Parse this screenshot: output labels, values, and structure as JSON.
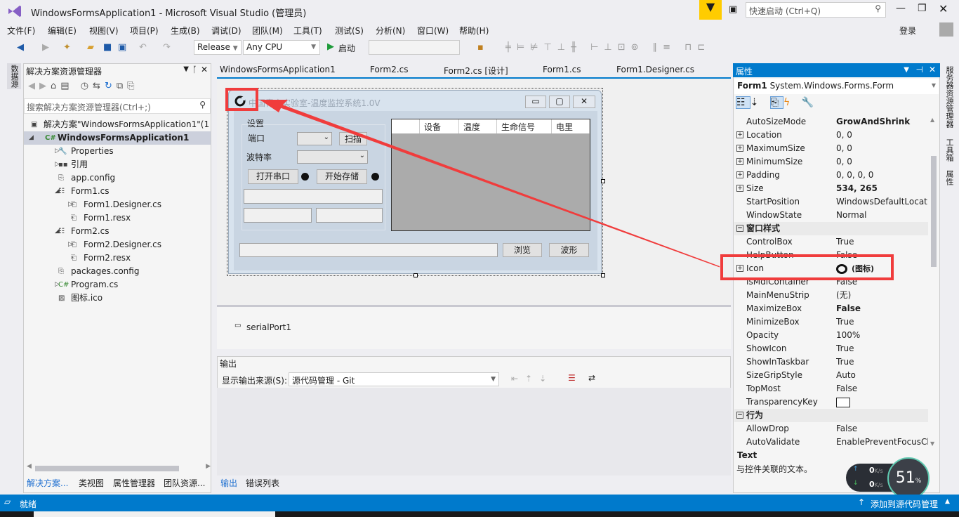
{
  "window": {
    "title": "WindowsFormsApplication1 - Microsoft Visual Studio (管理员)",
    "quick_launch_placeholder": "快速启动 (Ctrl+Q)",
    "login": "登录"
  },
  "menu": [
    "文件(F)",
    "编辑(E)",
    "视图(V)",
    "项目(P)",
    "生成(B)",
    "调试(D)",
    "团队(M)",
    "工具(T)",
    "测试(S)",
    "分析(N)",
    "窗口(W)",
    "帮助(H)"
  ],
  "toolbar": {
    "config": "Release",
    "platform": "Any CPU",
    "start": "启动"
  },
  "left_vertical_tab": "数据源",
  "right_vertical_tabs": [
    "服务器资源管理器",
    "工具箱",
    "属性"
  ],
  "solution_explorer": {
    "title": "解决方案资源管理器",
    "search_placeholder": "搜索解决方案资源管理器(Ctrl+;)",
    "items": [
      {
        "label": "解决方案\"WindowsFormsApplication1\"(1",
        "indent": 0,
        "arrow": "",
        "icon": "solution-icon"
      },
      {
        "label": "WindowsFormsApplication1",
        "indent": 0,
        "arrow": "◢",
        "icon": "csharp-project-icon",
        "selected": true
      },
      {
        "label": "Properties",
        "indent": 1,
        "arrow": "▷",
        "icon": "wrench-icon"
      },
      {
        "label": "引用",
        "indent": 1,
        "arrow": "▷",
        "icon": "references-icon"
      },
      {
        "label": "app.config",
        "indent": 1,
        "arrow": "",
        "icon": "config-icon"
      },
      {
        "label": "Form1.cs",
        "indent": 1,
        "arrow": "◢",
        "icon": "form-icon"
      },
      {
        "label": "Form1.Designer.cs",
        "indent": 2,
        "arrow": "▷",
        "icon": "cs-file-icon"
      },
      {
        "label": "Form1.resx",
        "indent": 2,
        "arrow": "",
        "icon": "resx-file-icon"
      },
      {
        "label": "Form2.cs",
        "indent": 1,
        "arrow": "◢",
        "icon": "form-icon"
      },
      {
        "label": "Form2.Designer.cs",
        "indent": 2,
        "arrow": "▷",
        "icon": "cs-file-icon"
      },
      {
        "label": "Form2.resx",
        "indent": 2,
        "arrow": "",
        "icon": "resx-file-icon"
      },
      {
        "label": "packages.config",
        "indent": 1,
        "arrow": "",
        "icon": "config-icon"
      },
      {
        "label": "Program.cs",
        "indent": 1,
        "arrow": "▷",
        "icon": "csharp-file-icon"
      },
      {
        "label": "图标.ico",
        "indent": 1,
        "arrow": "",
        "icon": "ico-file-icon"
      }
    ],
    "bottom_tabs": [
      "解决方案...",
      "类视图",
      "属性管理器",
      "团队资源..."
    ]
  },
  "doc_tabs": [
    "WindowsFormsApplication1",
    "Form2.cs",
    "Form2.cs [设计]",
    "Form1.cs",
    "Form1.Designer.cs"
  ],
  "designer": {
    "form_title": "中国青宝实验室-温度监控系统1.0V",
    "group_label": "设置",
    "port_label": "端口",
    "scan_button": "扫描",
    "baud_label": "波特率",
    "open_port_button": "打开串口",
    "start_save_button": "开始存储",
    "grid_columns": [
      "",
      "设备",
      "温度",
      "生命信号",
      "电里"
    ],
    "browse_button": "浏览",
    "wave_button": "波形",
    "component": "serialPort1"
  },
  "output": {
    "title": "输出",
    "source_label": "显示输出来源(S):",
    "source_value": "源代码管理 - Git",
    "tabs": [
      "输出",
      "错误列表"
    ]
  },
  "properties": {
    "title": "属性",
    "object": "Form1",
    "object_type": "System.Windows.Forms.Form",
    "rows": [
      {
        "name": "AutoSizeMode",
        "value": "GrowAndShrink",
        "bold": true
      },
      {
        "name": "Location",
        "value": "0, 0",
        "expand": true
      },
      {
        "name": "MaximumSize",
        "value": "0, 0",
        "expand": true
      },
      {
        "name": "MinimumSize",
        "value": "0, 0",
        "expand": true
      },
      {
        "name": "Padding",
        "value": "0, 0, 0, 0",
        "expand": true
      },
      {
        "name": "Size",
        "value": "534, 265",
        "expand": true,
        "bold": true
      },
      {
        "name": "StartPosition",
        "value": "WindowsDefaultLocati"
      },
      {
        "name": "WindowState",
        "value": "Normal"
      },
      {
        "category": "窗口样式"
      },
      {
        "name": "ControlBox",
        "value": "True"
      },
      {
        "name": "HelpButton",
        "value": "False"
      },
      {
        "name": "Icon",
        "value": "(图标)",
        "expand": true,
        "icon": true
      },
      {
        "name": "IsMdiContainer",
        "value": "False"
      },
      {
        "name": "MainMenuStrip",
        "value": "(无)"
      },
      {
        "name": "MaximizeBox",
        "value": "False",
        "bold": true
      },
      {
        "name": "MinimizeBox",
        "value": "True"
      },
      {
        "name": "Opacity",
        "value": "100%"
      },
      {
        "name": "ShowIcon",
        "value": "True"
      },
      {
        "name": "ShowInTaskbar",
        "value": "True"
      },
      {
        "name": "SizeGripStyle",
        "value": "Auto"
      },
      {
        "name": "TopMost",
        "value": "False"
      },
      {
        "name": "TransparencyKey",
        "value": "",
        "swatch": true
      },
      {
        "category": "行为"
      },
      {
        "name": "AllowDrop",
        "value": "False"
      },
      {
        "name": "AutoValidate",
        "value": "EnablePreventFocusCh"
      }
    ],
    "desc_title": "Text",
    "desc_text": "与控件关联的文本。"
  },
  "net_widget": {
    "up": "0",
    "down": "0",
    "unit": "K/s",
    "cpu_percent": "51",
    "percent_sign": "%"
  },
  "status": {
    "text": "就绪",
    "source_control": "添加到源代码管理"
  },
  "colors": {
    "accent": "#007acc",
    "annotation": "#f03c3c"
  }
}
